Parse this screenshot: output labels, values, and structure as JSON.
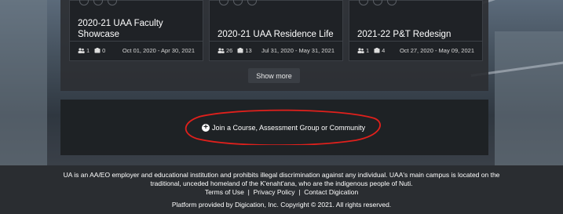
{
  "cards": [
    {
      "title": "2020-21 UAA Faculty Showcase",
      "members": "1",
      "items": "0",
      "dates": "Oct 01, 2020 - Apr 30, 2021"
    },
    {
      "title": "2020-21 UAA Residence Life",
      "members": "26",
      "items": "13",
      "dates": "Jul 31, 2020 - May 31, 2021"
    },
    {
      "title": "2021-22 P&T Redesign",
      "members": "1",
      "items": "4",
      "dates": "Oct 27, 2020 - May 09, 2021"
    }
  ],
  "show_more_label": "Show more",
  "join_label": "Join a Course, Assessment Group or Community",
  "footer": {
    "disclaimer_line1": "UA is an AA/EO employer and educational institution and prohibits illegal discrimination against any individual. UAA's main campus is located on the",
    "disclaimer_line2": "traditional, unceded homeland of the K'enaht'ana, who are the indigenous people of Nuti.",
    "terms_label": "Terms of Use",
    "privacy_label": "Privacy Policy",
    "contact_label": "Contact Digication",
    "separator": "|",
    "provided_by": "Platform provided by Digication, Inc. Copyright © 2021. All rights reserved."
  },
  "colors": {
    "annotation_oval": "#e0201c",
    "card_bg": "#1f2226",
    "footer_bg": "#2a2d31"
  }
}
